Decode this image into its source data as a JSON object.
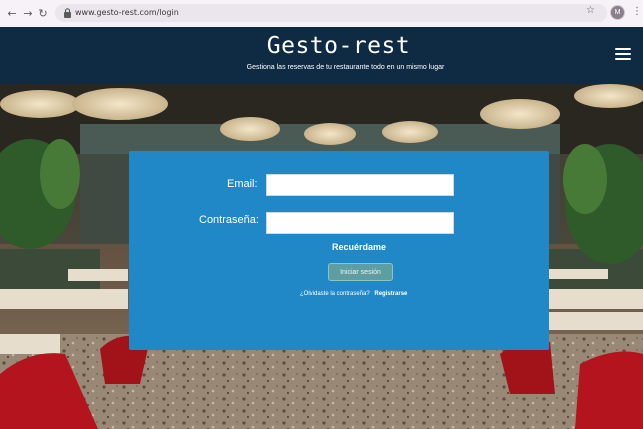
{
  "browser": {
    "url": "www.gesto-rest.com/login",
    "profile_initial": "M"
  },
  "header": {
    "title": "Gesto-rest",
    "subtitle": "Gestiona las reservas de tu restaurante todo en un mismo lugar"
  },
  "login": {
    "email_label": "Email:",
    "email_value": "",
    "password_label": "Contraseña:",
    "password_value": "",
    "remember_label": "Recuérdame",
    "submit_label": "Iniciar sesión",
    "forgot_label": "¿Olvidaste la contraseña?",
    "register_label": "Registrarse"
  },
  "colors": {
    "header_bg": "#0f2b43",
    "panel_bg": "#2088c7",
    "button_bg": "#5e9ea3"
  },
  "icons": {
    "back": "arrow-left-icon",
    "forward": "arrow-right-icon",
    "reload": "reload-icon",
    "lock": "lock-icon",
    "bookmark": "star-icon",
    "menu": "kebab-icon",
    "site_menu": "hamburger-icon"
  }
}
